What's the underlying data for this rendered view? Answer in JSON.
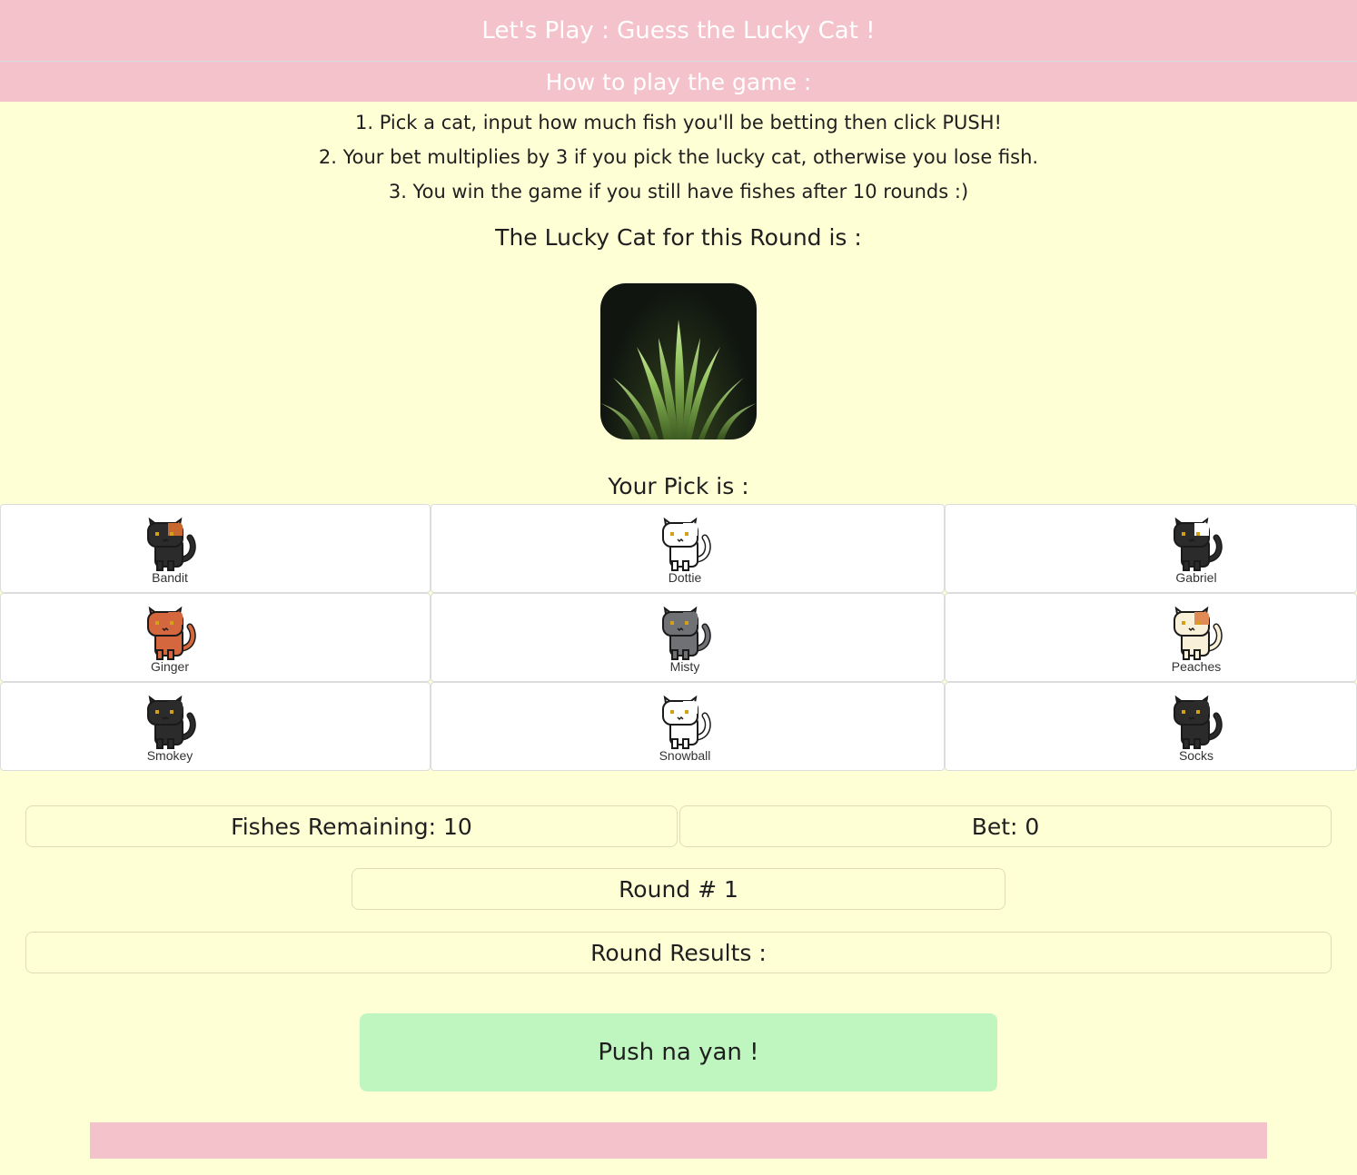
{
  "header": {
    "title": "Let's Play : Guess the Lucky Cat !"
  },
  "howto": {
    "title": "How to play the game :",
    "rules": [
      "1. Pick a cat, input how much fish you'll be betting then click PUSH!",
      "2. Your bet multiplies by 3 if you pick the lucky cat, otherwise you lose fish.",
      "3. You win the game if you still have fishes after 10 rounds :)"
    ]
  },
  "lucky": {
    "title": "The Lucky Cat for this Round is :",
    "image": "grass-icon"
  },
  "pick": {
    "title": "Your Pick is :"
  },
  "cats": [
    {
      "name": "Bandit",
      "icon": "cat-bandit-icon",
      "body": "#2b2b2b",
      "patch": "#c8682e"
    },
    {
      "name": "Dottie",
      "icon": "cat-dottie-icon",
      "body": "#ffffff",
      "patch": "#ffffff"
    },
    {
      "name": "Gabriel",
      "icon": "cat-gabriel-icon",
      "body": "#2b2b2b",
      "patch": "#ffffff"
    },
    {
      "name": "Ginger",
      "icon": "cat-ginger-icon",
      "body": "#d4673e",
      "patch": "#d4673e"
    },
    {
      "name": "Misty",
      "icon": "cat-misty-icon",
      "body": "#6f7174",
      "patch": "#6f7174"
    },
    {
      "name": "Peaches",
      "icon": "cat-peaches-icon",
      "body": "#f8f0d8",
      "patch": "#e08a55"
    },
    {
      "name": "Smokey",
      "icon": "cat-smokey-icon",
      "body": "#2b2b2b",
      "patch": "#2b2b2b"
    },
    {
      "name": "Snowball",
      "icon": "cat-snowball-icon",
      "body": "#ffffff",
      "patch": "#ffffff"
    },
    {
      "name": "Socks",
      "icon": "cat-socks-icon",
      "body": "#2b2b2b",
      "patch": "#2b2b2b"
    }
  ],
  "stats": {
    "fishes": "Fishes Remaining: 10",
    "bet": "Bet: 0",
    "round": "Round # 1",
    "results": "Round Results :"
  },
  "push": {
    "label": "Push na yan !"
  },
  "colors": {
    "pink": "#f4c2cb",
    "cream": "#ffffd6",
    "green": "#bff5bf"
  }
}
